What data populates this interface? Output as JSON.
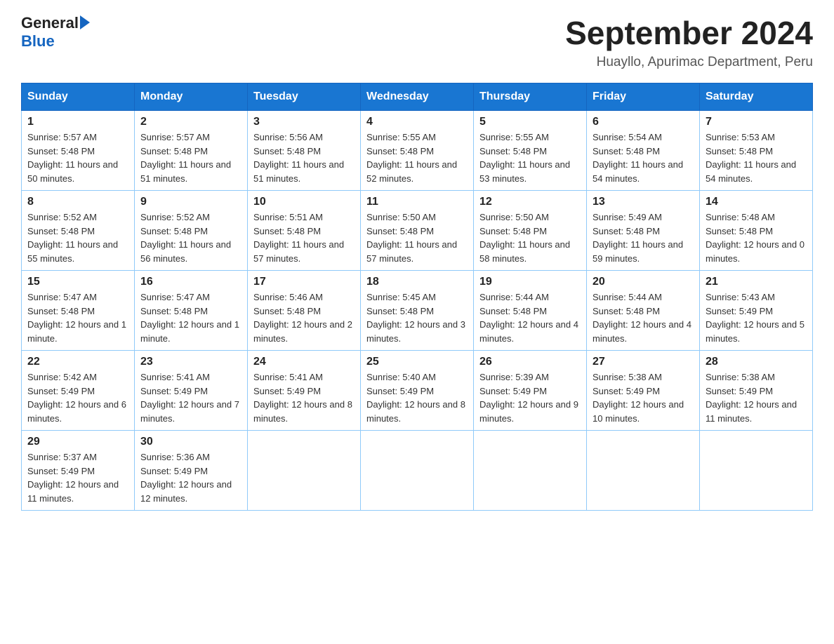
{
  "header": {
    "logo_general": "General",
    "logo_blue": "Blue",
    "month_year": "September 2024",
    "location": "Huayllo, Apurimac Department, Peru"
  },
  "days_of_week": [
    "Sunday",
    "Monday",
    "Tuesday",
    "Wednesday",
    "Thursday",
    "Friday",
    "Saturday"
  ],
  "weeks": [
    [
      {
        "day": "1",
        "sunrise": "5:57 AM",
        "sunset": "5:48 PM",
        "daylight": "11 hours and 50 minutes."
      },
      {
        "day": "2",
        "sunrise": "5:57 AM",
        "sunset": "5:48 PM",
        "daylight": "11 hours and 51 minutes."
      },
      {
        "day": "3",
        "sunrise": "5:56 AM",
        "sunset": "5:48 PM",
        "daylight": "11 hours and 51 minutes."
      },
      {
        "day": "4",
        "sunrise": "5:55 AM",
        "sunset": "5:48 PM",
        "daylight": "11 hours and 52 minutes."
      },
      {
        "day": "5",
        "sunrise": "5:55 AM",
        "sunset": "5:48 PM",
        "daylight": "11 hours and 53 minutes."
      },
      {
        "day": "6",
        "sunrise": "5:54 AM",
        "sunset": "5:48 PM",
        "daylight": "11 hours and 54 minutes."
      },
      {
        "day": "7",
        "sunrise": "5:53 AM",
        "sunset": "5:48 PM",
        "daylight": "11 hours and 54 minutes."
      }
    ],
    [
      {
        "day": "8",
        "sunrise": "5:52 AM",
        "sunset": "5:48 PM",
        "daylight": "11 hours and 55 minutes."
      },
      {
        "day": "9",
        "sunrise": "5:52 AM",
        "sunset": "5:48 PM",
        "daylight": "11 hours and 56 minutes."
      },
      {
        "day": "10",
        "sunrise": "5:51 AM",
        "sunset": "5:48 PM",
        "daylight": "11 hours and 57 minutes."
      },
      {
        "day": "11",
        "sunrise": "5:50 AM",
        "sunset": "5:48 PM",
        "daylight": "11 hours and 57 minutes."
      },
      {
        "day": "12",
        "sunrise": "5:50 AM",
        "sunset": "5:48 PM",
        "daylight": "11 hours and 58 minutes."
      },
      {
        "day": "13",
        "sunrise": "5:49 AM",
        "sunset": "5:48 PM",
        "daylight": "11 hours and 59 minutes."
      },
      {
        "day": "14",
        "sunrise": "5:48 AM",
        "sunset": "5:48 PM",
        "daylight": "12 hours and 0 minutes."
      }
    ],
    [
      {
        "day": "15",
        "sunrise": "5:47 AM",
        "sunset": "5:48 PM",
        "daylight": "12 hours and 1 minute."
      },
      {
        "day": "16",
        "sunrise": "5:47 AM",
        "sunset": "5:48 PM",
        "daylight": "12 hours and 1 minute."
      },
      {
        "day": "17",
        "sunrise": "5:46 AM",
        "sunset": "5:48 PM",
        "daylight": "12 hours and 2 minutes."
      },
      {
        "day": "18",
        "sunrise": "5:45 AM",
        "sunset": "5:48 PM",
        "daylight": "12 hours and 3 minutes."
      },
      {
        "day": "19",
        "sunrise": "5:44 AM",
        "sunset": "5:48 PM",
        "daylight": "12 hours and 4 minutes."
      },
      {
        "day": "20",
        "sunrise": "5:44 AM",
        "sunset": "5:48 PM",
        "daylight": "12 hours and 4 minutes."
      },
      {
        "day": "21",
        "sunrise": "5:43 AM",
        "sunset": "5:49 PM",
        "daylight": "12 hours and 5 minutes."
      }
    ],
    [
      {
        "day": "22",
        "sunrise": "5:42 AM",
        "sunset": "5:49 PM",
        "daylight": "12 hours and 6 minutes."
      },
      {
        "day": "23",
        "sunrise": "5:41 AM",
        "sunset": "5:49 PM",
        "daylight": "12 hours and 7 minutes."
      },
      {
        "day": "24",
        "sunrise": "5:41 AM",
        "sunset": "5:49 PM",
        "daylight": "12 hours and 8 minutes."
      },
      {
        "day": "25",
        "sunrise": "5:40 AM",
        "sunset": "5:49 PM",
        "daylight": "12 hours and 8 minutes."
      },
      {
        "day": "26",
        "sunrise": "5:39 AM",
        "sunset": "5:49 PM",
        "daylight": "12 hours and 9 minutes."
      },
      {
        "day": "27",
        "sunrise": "5:38 AM",
        "sunset": "5:49 PM",
        "daylight": "12 hours and 10 minutes."
      },
      {
        "day": "28",
        "sunrise": "5:38 AM",
        "sunset": "5:49 PM",
        "daylight": "12 hours and 11 minutes."
      }
    ],
    [
      {
        "day": "29",
        "sunrise": "5:37 AM",
        "sunset": "5:49 PM",
        "daylight": "12 hours and 11 minutes."
      },
      {
        "day": "30",
        "sunrise": "5:36 AM",
        "sunset": "5:49 PM",
        "daylight": "12 hours and 12 minutes."
      },
      null,
      null,
      null,
      null,
      null
    ]
  ],
  "labels": {
    "sunrise_prefix": "Sunrise: ",
    "sunset_prefix": "Sunset: ",
    "daylight_prefix": "Daylight: "
  }
}
